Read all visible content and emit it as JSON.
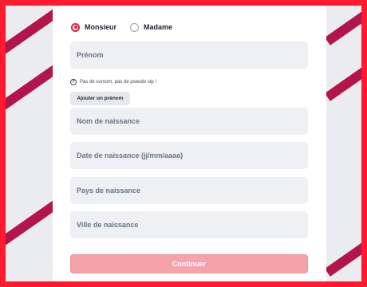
{
  "civility": {
    "options": [
      {
        "label": "Monsieur",
        "selected": true
      },
      {
        "label": "Madame",
        "selected": false
      }
    ]
  },
  "fields": {
    "prenom": {
      "placeholder": "Prénom"
    },
    "nom_naissance": {
      "placeholder": "Nom de naissance"
    },
    "date_naissance": {
      "placeholder": "Date de naissance (jj/mm/aaaa)"
    },
    "pays_naissance": {
      "placeholder": "Pays de naissance"
    },
    "ville_naissance": {
      "placeholder": "Ville de naissance"
    }
  },
  "hint": {
    "icon": "question-icon",
    "text": "Pas de surnom, pas de pseudo stp !"
  },
  "add_firstname_label": "Ajouter un prénom",
  "continue_label": "Continuer",
  "colors": {
    "accent": "#e01a34",
    "frame": "#ff1a2e",
    "button_disabled": "#f5a3ab"
  }
}
